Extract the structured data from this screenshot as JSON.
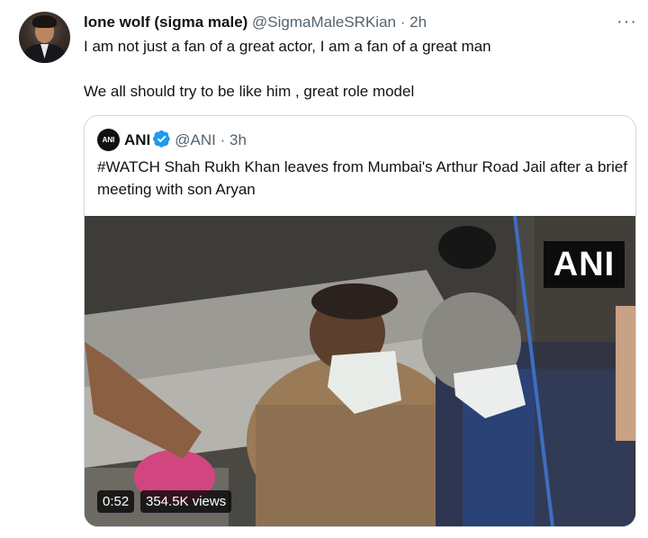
{
  "tweet": {
    "display_name": "lone wolf (sigma male)",
    "handle": "@SigmaMaleSRKian",
    "separator": "·",
    "time": "2h",
    "more_icon": "more-horizontal-icon",
    "text_line1": "I am not just a fan of a great actor, I am a fan of a great man",
    "text_line2": "We all should try to be like him , great role model"
  },
  "quote": {
    "display_name": "ANI",
    "verified_icon": "verified-badge-icon",
    "handle": "@ANI",
    "separator": "·",
    "time": "3h",
    "text": "#WATCH Shah Rukh Khan leaves from Mumbai's Arthur Road Jail after a brief meeting with son Aryan",
    "video": {
      "watermark": "ANI",
      "duration": "0:52",
      "views": "354.5K views"
    }
  },
  "colors": {
    "text_primary": "#0f1419",
    "text_secondary": "#536471",
    "border": "#cfd9de",
    "verified": "#1d9bf0"
  }
}
